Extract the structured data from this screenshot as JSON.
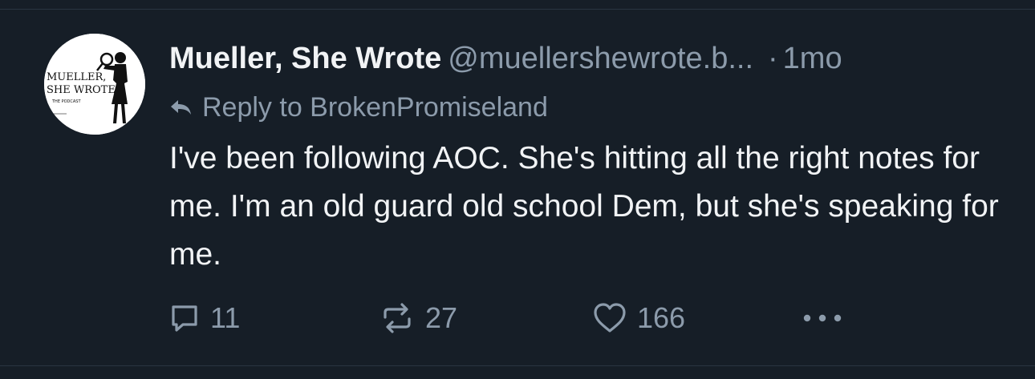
{
  "post": {
    "author": {
      "display_name": "Mueller, She Wrote",
      "handle": "@muellershewrote.b...",
      "avatar_text": [
        "MUELLER,",
        "SHE WROTE",
        "THE PODCAST"
      ]
    },
    "separator": "·",
    "timestamp": "1mo",
    "reply_label": "Reply to BrokenPromiseland",
    "text": "I've been following AOC. She's hitting all the right notes for me. I'm an old guard old school Dem, but she's speaking for me."
  },
  "actions": {
    "reply_count": "11",
    "repost_count": "27",
    "like_count": "166",
    "reply_icon": "comment-icon",
    "repost_icon": "repost-icon",
    "like_icon": "heart-icon",
    "more_icon": "more-icon"
  },
  "colors": {
    "background": "#161e27",
    "text_primary": "#f1f3f5",
    "text_secondary": "#8c9bab",
    "divider": "#2a3441"
  }
}
